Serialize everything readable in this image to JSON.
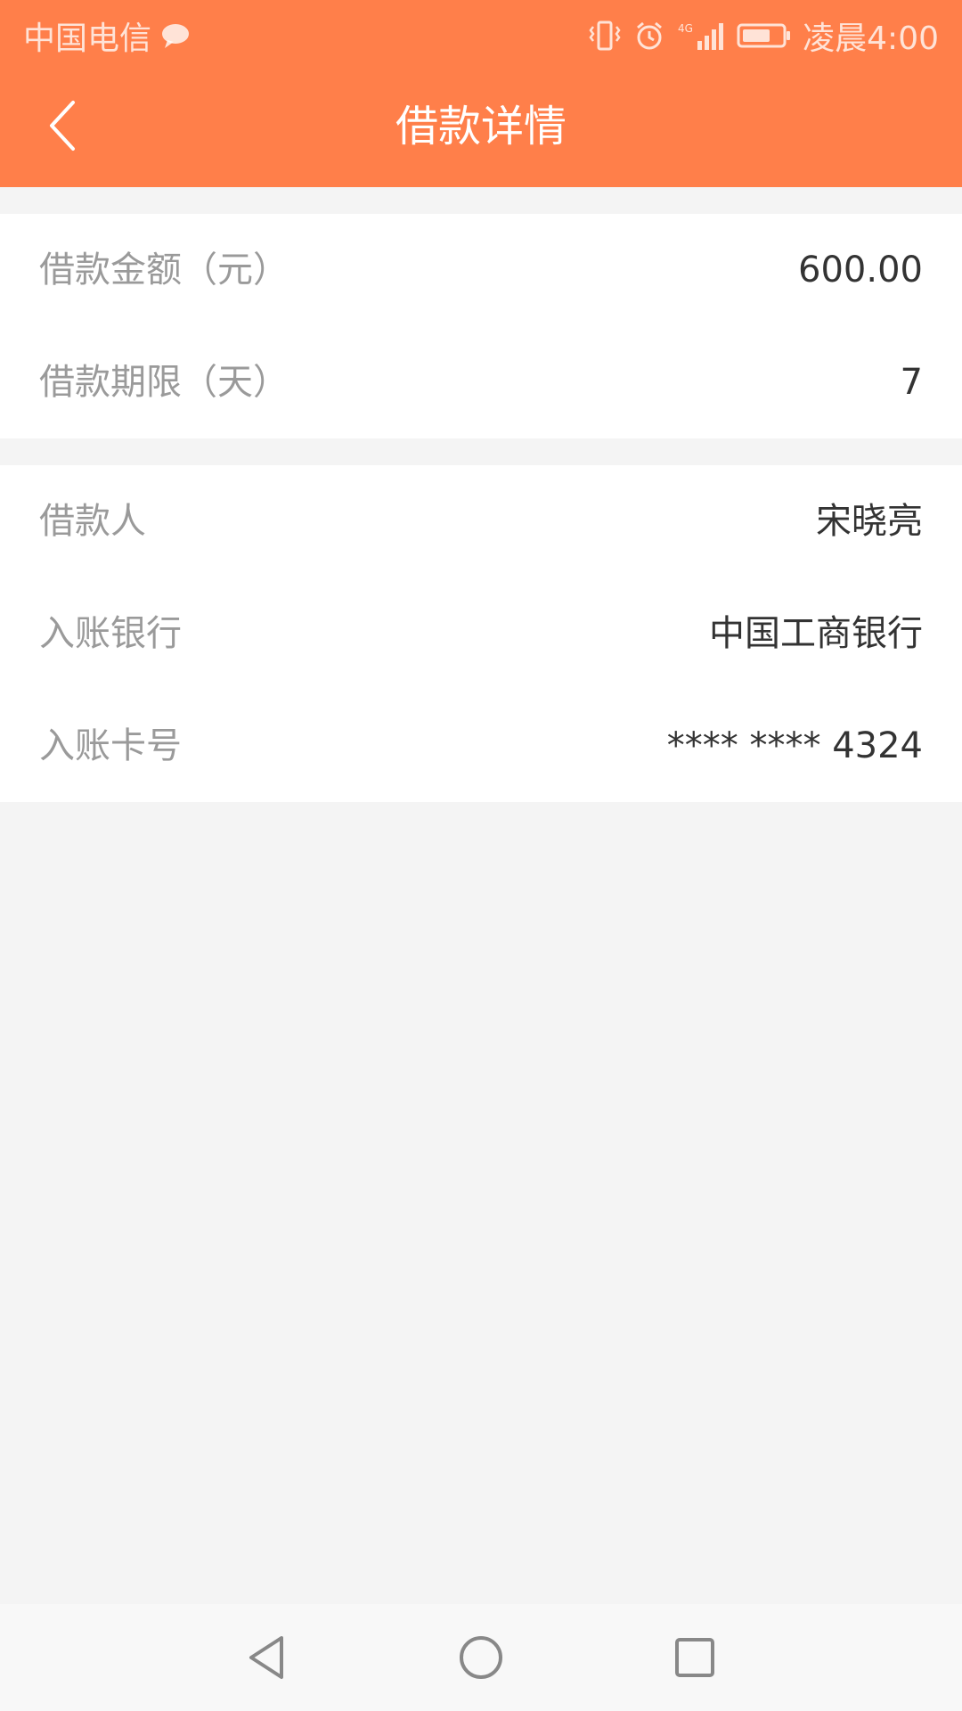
{
  "status_bar": {
    "carrier": "中国电信",
    "time": "凌晨4:00",
    "network_label": "4G",
    "icons": [
      "message-bubble-icon",
      "vibrate-icon",
      "alarm-icon",
      "signal-icon",
      "battery-icon"
    ]
  },
  "header": {
    "title": "借款详情",
    "back_icon": "chevron-left-icon"
  },
  "loan_section": {
    "rows": [
      {
        "label": "借款金额（元）",
        "value": "600.00"
      },
      {
        "label": "借款期限（天）",
        "value": "7"
      }
    ]
  },
  "account_section": {
    "rows": [
      {
        "label": "借款人",
        "value": "宋晓亮"
      },
      {
        "label": "入账银行",
        "value": "中国工商银行"
      },
      {
        "label": "入账卡号",
        "value": "**** **** 4324"
      }
    ]
  },
  "nav_bar": {
    "icons": [
      "back-triangle-icon",
      "home-circle-icon",
      "recent-square-icon"
    ]
  },
  "colors": {
    "accent": "#ff7f4a",
    "background": "#f4f4f4",
    "label": "#9a9a9a",
    "value": "#333333"
  }
}
